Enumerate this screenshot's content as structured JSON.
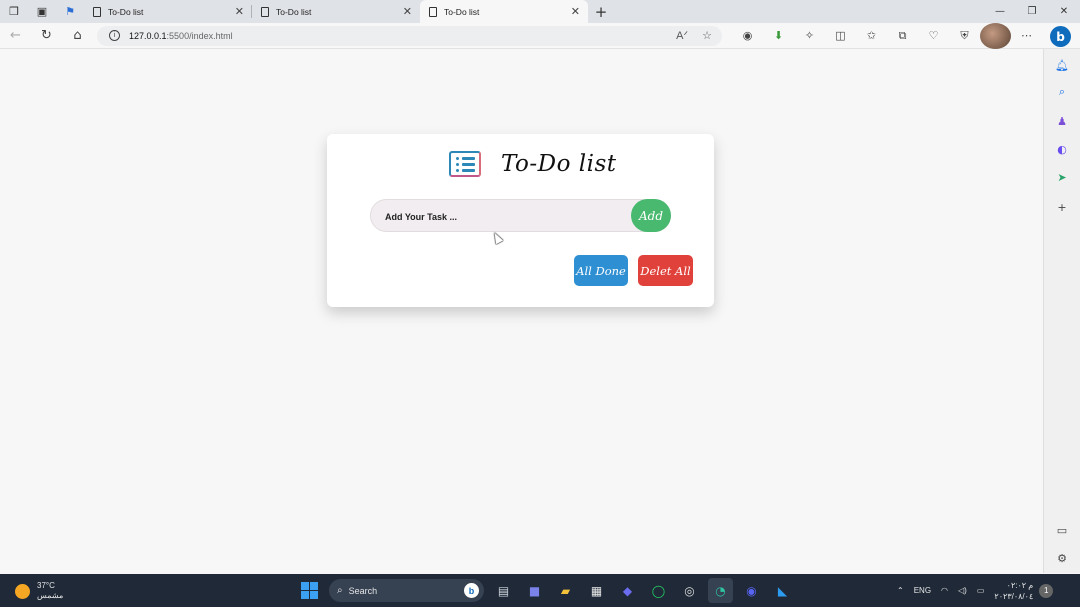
{
  "browser": {
    "tabs": [
      {
        "title": "To-Do list",
        "active": false
      },
      {
        "title": "To-Do list",
        "active": false
      },
      {
        "title": "To-Do list",
        "active": true
      }
    ],
    "new_tab_icon": "plus-icon",
    "url_host": "127.0.0.1",
    "url_path": ":5500/index.html",
    "window_controls": [
      "minimize-icon",
      "restore-icon",
      "close-icon"
    ]
  },
  "todo": {
    "title": "To-Do list",
    "input_placeholder": "Add Your Task ...",
    "add_label": "Add",
    "all_done_label": "All Done",
    "delete_all_label": "Delet All",
    "colors": {
      "add": "#48b96f",
      "all_done": "#2e8fd2",
      "delete_all": "#e0423b",
      "icon": "#2d88b8"
    }
  },
  "taskbar": {
    "weather_temp": "37°C",
    "weather_desc": "مشمس",
    "search_label": "Search",
    "language": "ENG",
    "time": "م ٠٢:٠٢",
    "date": "٢٠٢٣/٠٨/٠٤",
    "notification_count": "1"
  }
}
